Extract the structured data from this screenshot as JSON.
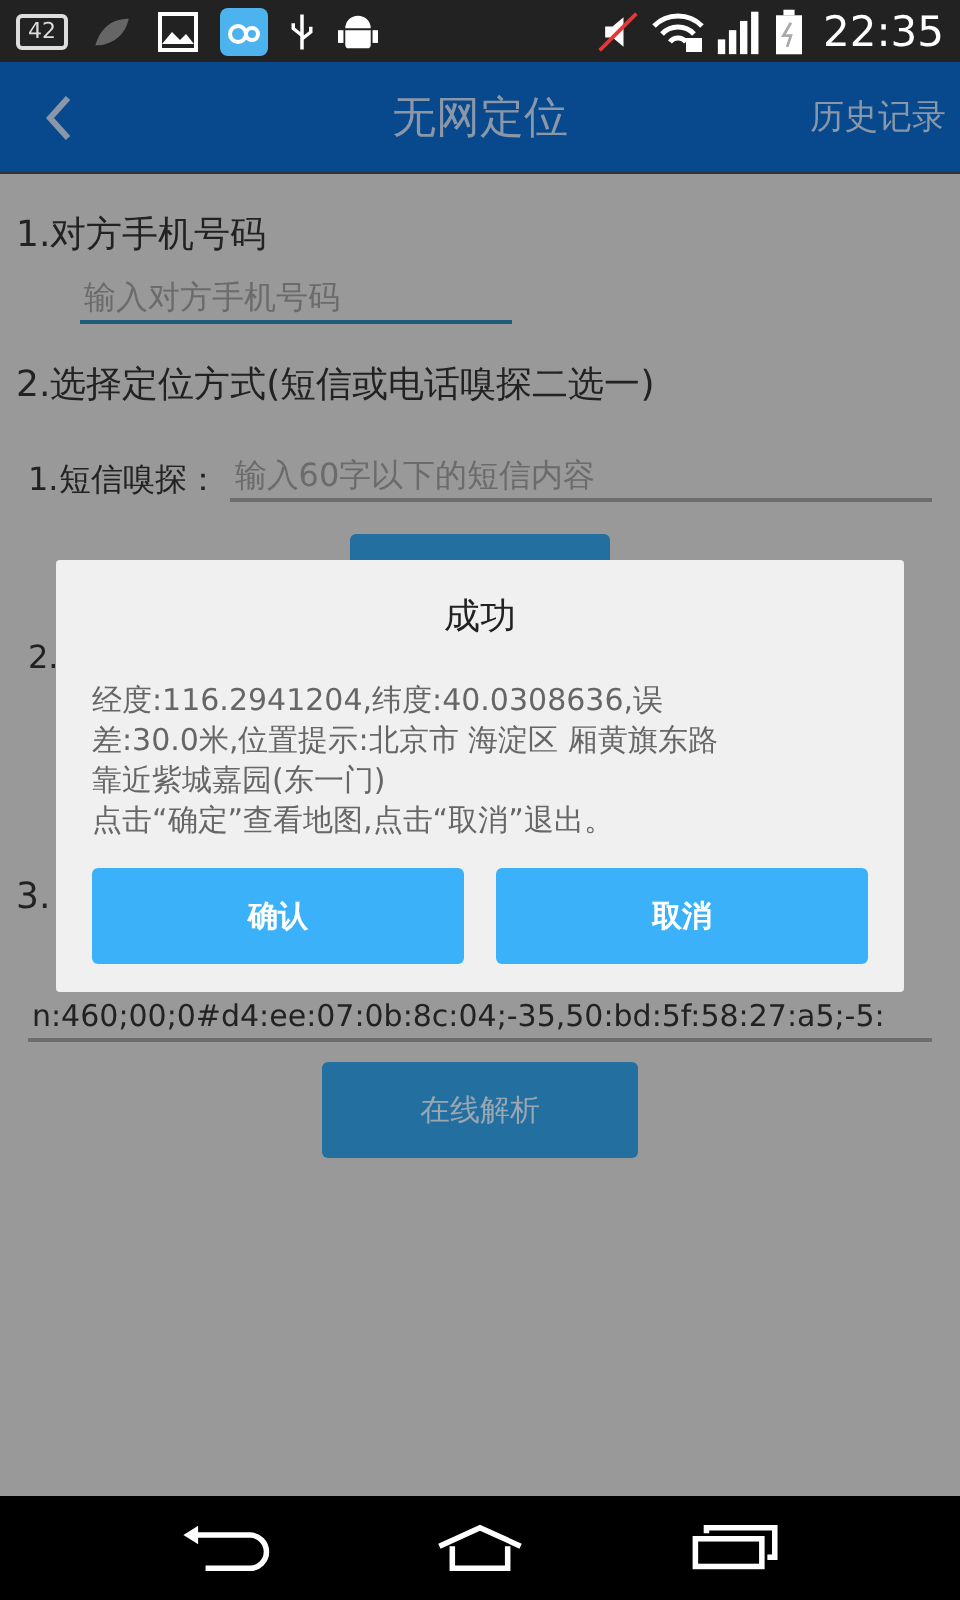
{
  "status_bar": {
    "badge": "42",
    "time": "22:35"
  },
  "header": {
    "title": "无网定位",
    "action": "历史记录"
  },
  "form": {
    "section_1": "1.对方手机号码",
    "phone_field": {
      "placeholder": "输入对方手机号码"
    },
    "section_2": "2.选择定位方式(短信或电话嗅探二选一)",
    "sms_row": {
      "label": "1.短信嗅探：",
      "placeholder": "输入60字以下的短信内容"
    },
    "option_2": "2.",
    "section_3": "3.",
    "data_field": {
      "value": "n:460;00;0#d4:ee:07:0b:8c:04;-35,50:bd:5f:58:27:a5;-5:"
    },
    "parse_button": "在线解析"
  },
  "dialog": {
    "title": "成功",
    "message_lines": [
      "经度:116.2941204,纬度:40.0308636,误",
      "差:30.0米,位置提示:北京市 海淀区 厢黄旗东路",
      "靠近紫城嘉园(东一门)",
      "点击“确定”查看地图,点击“取消”退出。"
    ],
    "buttons": [
      {
        "label": "确认"
      },
      {
        "label": "取消"
      }
    ]
  }
}
